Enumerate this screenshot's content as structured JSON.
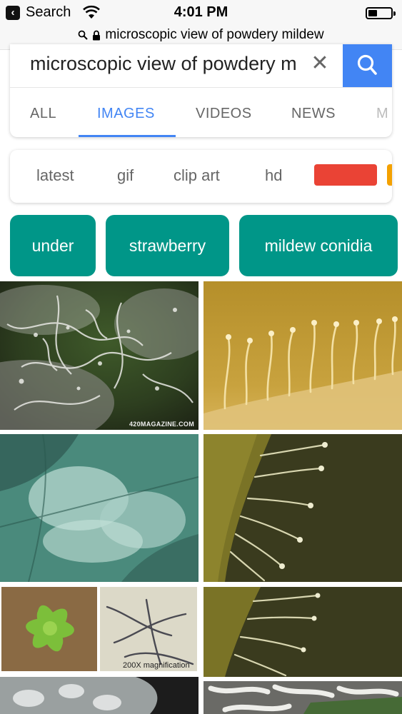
{
  "status_bar": {
    "back_label": "Search",
    "time": "4:01 PM",
    "battery_fraction": 0.3
  },
  "url_bar": {
    "url": "microscopic view of powdery mildew"
  },
  "search": {
    "query": "microscopic view of powdery m",
    "clear_glyph": "✕",
    "accent": "#4285f4"
  },
  "tabs": [
    {
      "label": "ALL",
      "active": false
    },
    {
      "label": "IMAGES",
      "active": true
    },
    {
      "label": "VIDEOS",
      "active": false
    },
    {
      "label": "NEWS",
      "active": false
    },
    {
      "label": "M",
      "active": false
    }
  ],
  "chips": [
    "latest",
    "gif",
    "clip art",
    "hd"
  ],
  "chip_colors": [
    "#ea4335",
    "#f4a100"
  ],
  "related": [
    "under",
    "strawberry",
    "mildew conidia"
  ],
  "related_color": "#009688",
  "images": [
    {
      "caption": "420MAGAZINE.COM"
    },
    {
      "caption": ""
    },
    {
      "caption": ""
    },
    {
      "caption": ""
    },
    {
      "caption": "200X magnification"
    },
    {
      "caption": ""
    },
    {
      "caption": ""
    },
    {
      "caption": ""
    }
  ],
  "icons": [
    "back-chevron-icon",
    "wifi-icon",
    "battery-icon",
    "search-icon",
    "lock-icon",
    "clear-icon"
  ]
}
